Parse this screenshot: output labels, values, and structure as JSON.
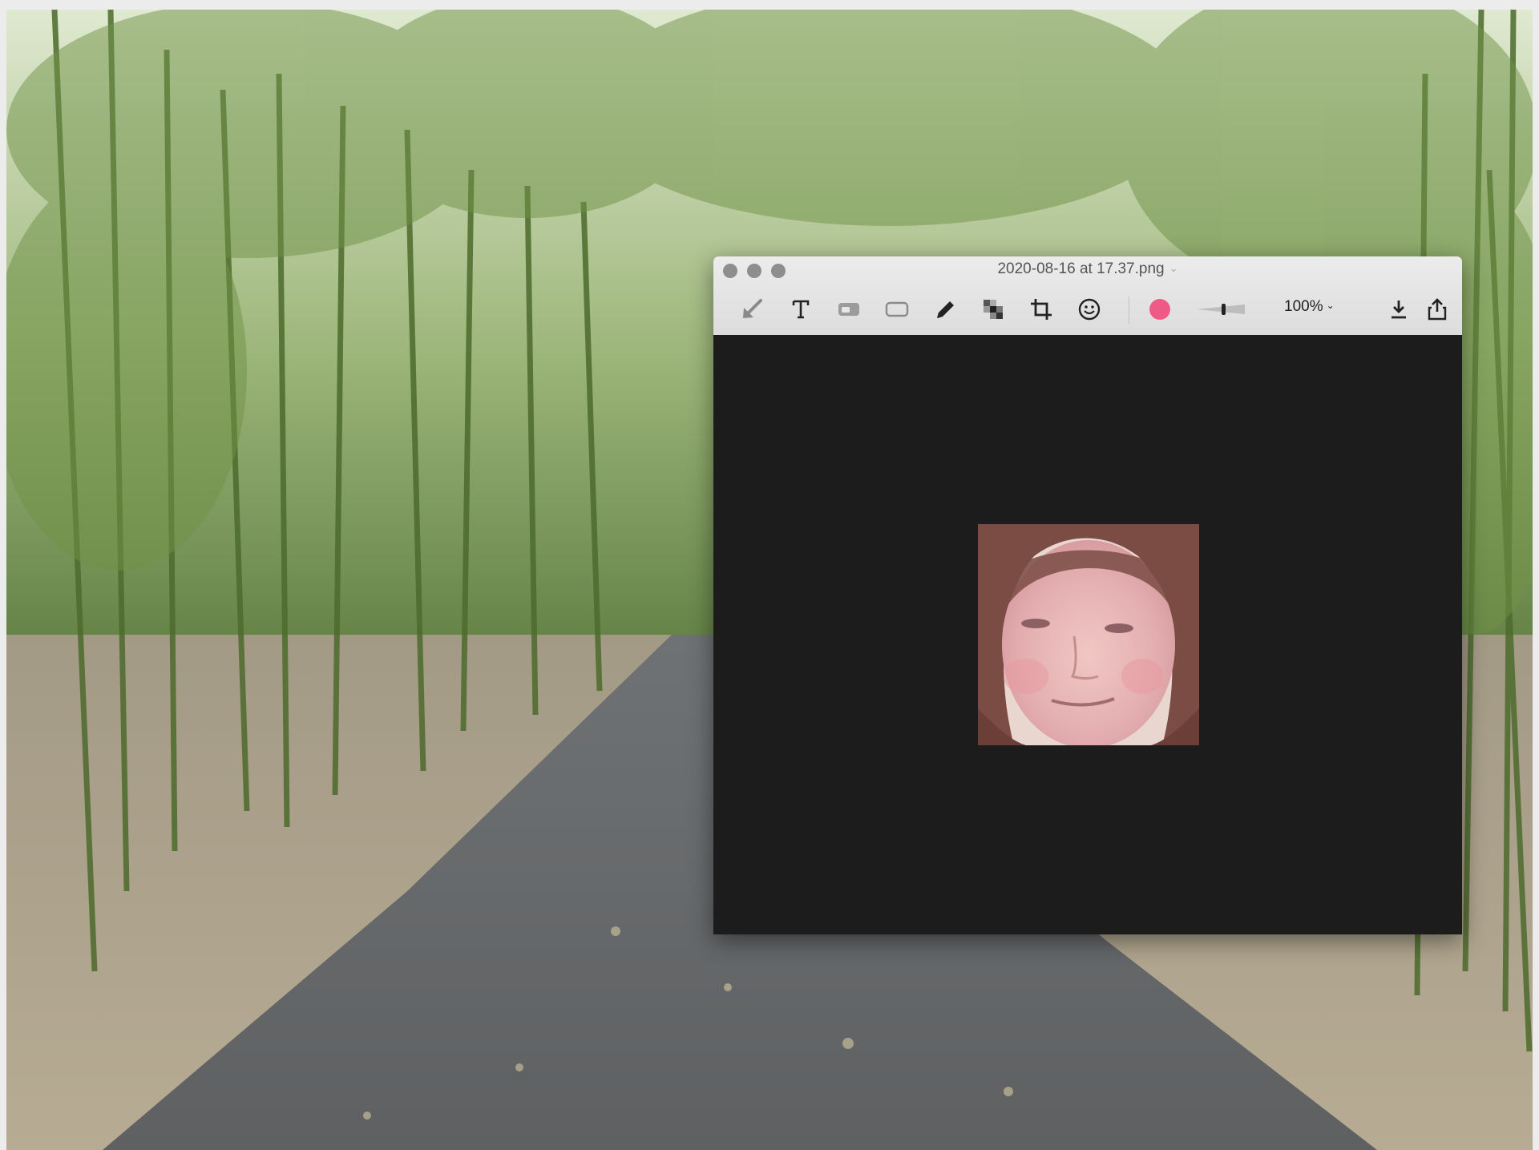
{
  "window": {
    "title": "2020-08-16 at 17.37.png",
    "title_chevron": "⌄"
  },
  "toolbar": {
    "tools": [
      {
        "name": "arrow-tool",
        "icon": "arrow-icon"
      },
      {
        "name": "text-tool",
        "icon": "text-icon"
      },
      {
        "name": "highlight-tool",
        "icon": "highlight-icon"
      },
      {
        "name": "rectangle-tool",
        "icon": "rectangle-icon"
      },
      {
        "name": "pen-tool",
        "icon": "pen-icon"
      },
      {
        "name": "pixelate-tool",
        "icon": "pixelate-icon"
      },
      {
        "name": "crop-tool",
        "icon": "crop-icon"
      },
      {
        "name": "emoji-tool",
        "icon": "emoji-icon"
      }
    ],
    "color": "#ef5b86",
    "zoom_label": "100%",
    "zoom_chevron": "⌄"
  },
  "colors": {
    "titlebar": "#e3e3e3",
    "canvas": "#1c1c1c",
    "icon": "#222222"
  }
}
